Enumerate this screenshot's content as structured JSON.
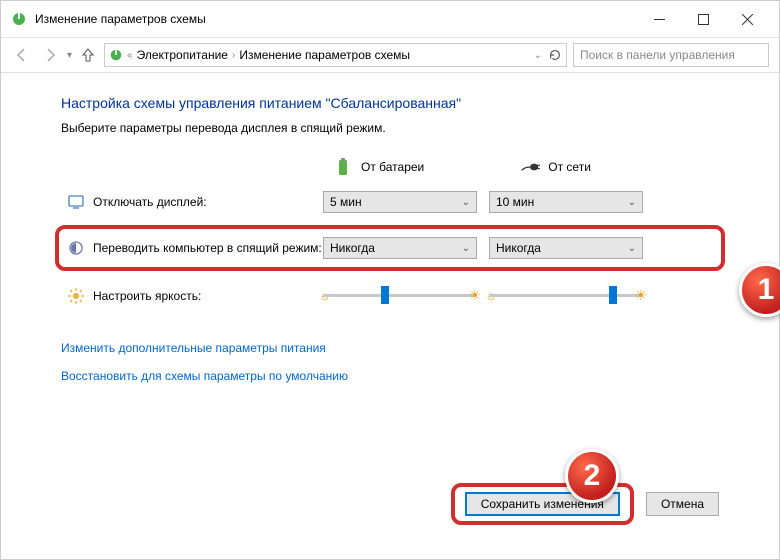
{
  "window": {
    "title": "Изменение параметров схемы"
  },
  "nav": {
    "crumb1": "Электропитание",
    "crumb2": "Изменение параметров схемы",
    "search_placeholder": "Поиск в панели управления"
  },
  "page": {
    "heading": "Настройка схемы управления питанием \"Сбалансированная\"",
    "subheading": "Выберите параметры перевода дисплея в спящий режим.",
    "col_battery": "От батареи",
    "col_ac": "От сети",
    "row_display": "Отключать дисплей:",
    "row_sleep": "Переводить компьютер в спящий режим:",
    "row_brightness": "Настроить яркость:",
    "display_battery": "5 мин",
    "display_ac": "10 мин",
    "sleep_battery": "Никогда",
    "sleep_ac": "Никогда",
    "link_advanced": "Изменить дополнительные параметры питания",
    "link_restore": "Восстановить для схемы параметры по умолчанию",
    "btn_save": "Сохранить изменения",
    "btn_cancel": "Отмена"
  },
  "annotations": {
    "badge1": "1",
    "badge2": "2"
  }
}
